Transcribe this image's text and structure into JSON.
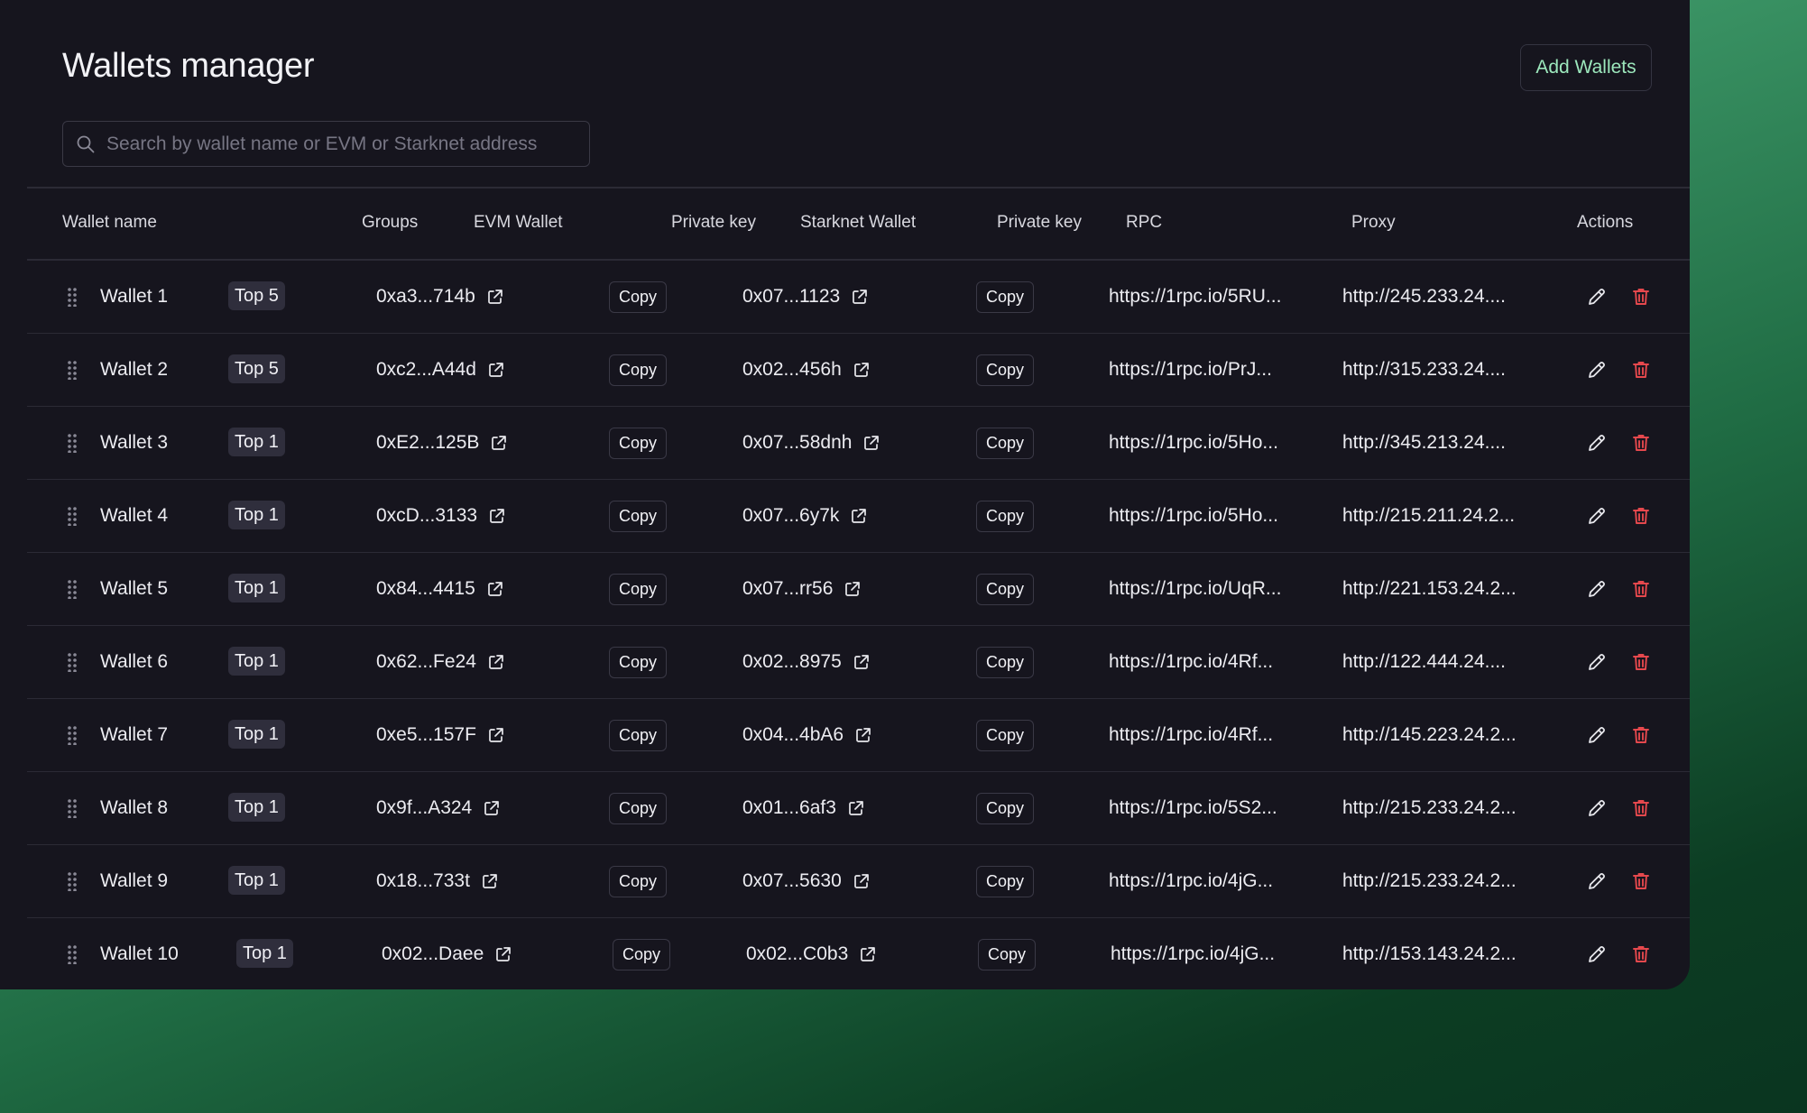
{
  "page": {
    "title": "Wallets manager",
    "add_button": "Add Wallets"
  },
  "search": {
    "placeholder": "Search by wallet name or EVM or Starknet address"
  },
  "columns": {
    "wallet_name": "Wallet name",
    "groups": "Groups",
    "evm_wallet": "EVM Wallet",
    "evm_private_key": "Private key",
    "starknet_wallet": "Starknet Wallet",
    "starknet_private_key": "Private key",
    "rpc": "RPC",
    "proxy": "Proxy",
    "actions": "Actions"
  },
  "copy_label": "Copy",
  "rows": [
    {
      "name": "Wallet 1",
      "group": "Top 5",
      "evm": "0xa3...714b",
      "starknet": "0x07...1123",
      "rpc": "https://1rpc.io/5RU...",
      "proxy": "http://245.233.24...."
    },
    {
      "name": "Wallet 2",
      "group": "Top 5",
      "evm": "0xc2...A44d",
      "starknet": "0x02...456h",
      "rpc": "https://1rpc.io/PrJ...",
      "proxy": "http://315.233.24...."
    },
    {
      "name": "Wallet 3",
      "group": "Top 1",
      "evm": "0xE2...125B",
      "starknet": "0x07...58dnh",
      "rpc": "https://1rpc.io/5Ho...",
      "proxy": "http://345.213.24...."
    },
    {
      "name": "Wallet 4",
      "group": "Top 1",
      "evm": "0xcD...3133",
      "starknet": "0x07...6y7k",
      "rpc": "https://1rpc.io/5Ho...",
      "proxy": "http://215.211.24.2..."
    },
    {
      "name": "Wallet 5",
      "group": "Top 1",
      "evm": "0x84...4415",
      "starknet": "0x07...rr56",
      "rpc": "https://1rpc.io/UqR...",
      "proxy": "http://221.153.24.2..."
    },
    {
      "name": "Wallet 6",
      "group": "Top 1",
      "evm": "0x62...Fe24",
      "starknet": "0x02...8975",
      "rpc": "https://1rpc.io/4Rf...",
      "proxy": "http://122.444.24...."
    },
    {
      "name": "Wallet 7",
      "group": "Top 1",
      "evm": "0xe5...157F",
      "starknet": "0x04...4bA6",
      "rpc": "https://1rpc.io/4Rf...",
      "proxy": "http://145.223.24.2..."
    },
    {
      "name": "Wallet 8",
      "group": "Top 1",
      "evm": "0x9f...A324",
      "starknet": "0x01...6af3",
      "rpc": "https://1rpc.io/5S2...",
      "proxy": "http://215.233.24.2..."
    },
    {
      "name": "Wallet 9",
      "group": "Top 1",
      "evm": "0x18...733t",
      "starknet": "0x07...5630",
      "rpc": "https://1rpc.io/4jG...",
      "proxy": "http://215.233.24.2..."
    },
    {
      "name": "Wallet 10",
      "group": "Top 1",
      "evm": "0x02...Daee",
      "starknet": "0x02...C0b3",
      "rpc": "https://1rpc.io/4jG...",
      "proxy": "http://153.143.24.2..."
    }
  ],
  "colors": {
    "panel_bg": "#16151e",
    "accent_green": "#9ce7bc",
    "delete_red": "#e5484d",
    "badge_bg": "#2f2e3c"
  },
  "icons": {
    "search": "search-icon",
    "drag": "drag-handle-icon",
    "external": "external-link-icon",
    "edit": "pencil-icon",
    "delete": "trash-icon"
  }
}
